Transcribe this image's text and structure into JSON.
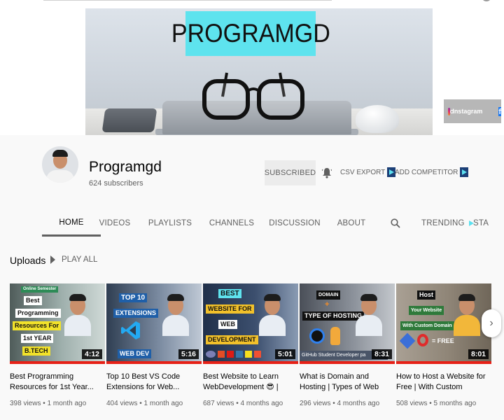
{
  "banner": {
    "logo_text": "PROGRAMGD",
    "instagram_label": "Instagram",
    "facebook_letter": "f"
  },
  "channel": {
    "name": "Programgd",
    "subscribers": "624 subscribers",
    "subscribe_label": "SUBSCRIBED",
    "csv_export_label": "CSV EXPORT",
    "add_competitor_label": "ADD COMPETITOR"
  },
  "tabs": [
    {
      "label": "HOME",
      "active": true
    },
    {
      "label": "VIDEOS"
    },
    {
      "label": "PLAYLISTS"
    },
    {
      "label": "CHANNELS"
    },
    {
      "label": "DISCUSSION"
    },
    {
      "label": "ABOUT"
    },
    {
      "label": "TRENDING"
    },
    {
      "label": "STA"
    }
  ],
  "uploads": {
    "title": "Uploads",
    "play_all": "PLAY ALL",
    "videos": [
      {
        "title": "Best Programming Resources for 1st Year...",
        "views": "398 views",
        "age": "1 month ago",
        "duration": "4:12",
        "thumb_text": [
          "Online Semester",
          "Best",
          "Programming",
          "Resources For",
          "1st YEAR",
          "B.TECH"
        ]
      },
      {
        "title": "Top 10 Best VS Code Extensions for Web...",
        "views": "404 views",
        "age": "1 month ago",
        "duration": "5:16",
        "thumb_text": [
          "TOP 10",
          "EXTENSIONS",
          "WEB DEV"
        ]
      },
      {
        "title": "Best Website to Learn WebDevelopment 😎 | FREE...",
        "views": "687 views",
        "age": "4 months ago",
        "duration": "5:01",
        "thumb_text": [
          "BEST",
          "WEBSITE FOR",
          "WEB",
          "DEVELOPMENT"
        ]
      },
      {
        "title": "What is Domain and Hosting | Types of Web Hosting | FRE...",
        "views": "296 views",
        "age": "4 months ago",
        "duration": "8:31",
        "thumb_text": [
          "DOMAIN",
          "TYPE OF HOSTING",
          "GitHub Student Developer pa"
        ]
      },
      {
        "title": "How to Host a Website for Free | With Custom Domain...",
        "views": "508 views",
        "age": "5 months ago",
        "duration": "8:01",
        "thumb_text": [
          "Host",
          "Your Website",
          "With Custom Domain",
          "= FREE"
        ]
      }
    ]
  },
  "colors": {
    "accent_red": "#e62117",
    "logo_cyan": "#5ee3ee",
    "text_secondary": "#606060"
  },
  "meta_separator": " • "
}
